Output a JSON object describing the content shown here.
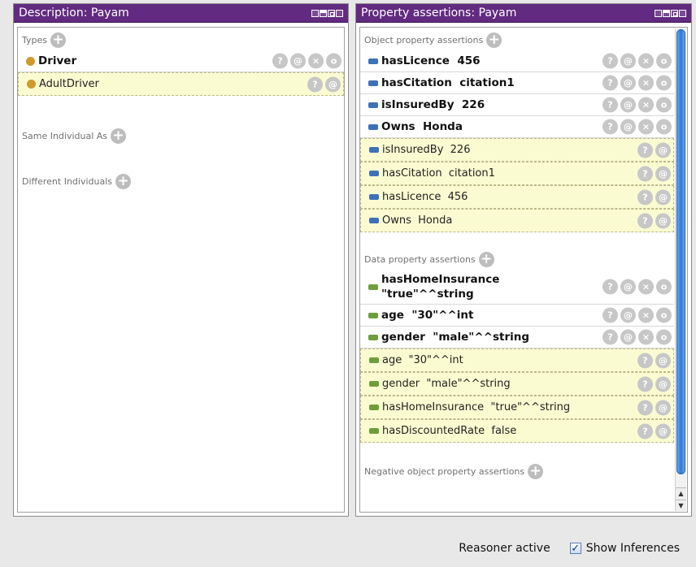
{
  "left": {
    "title": "Description: Payam",
    "types_header": "Types",
    "types_items": [
      {
        "label": "Driver",
        "inferred": false
      },
      {
        "label": "AdultDriver",
        "inferred": true
      }
    ],
    "same_header": "Same Individual As",
    "different_header": "Different Individuals"
  },
  "right": {
    "title": "Property assertions: Payam",
    "obj_header": "Object property assertions",
    "obj_asserted": [
      "hasLicence  456",
      "hasCitation  citation1",
      "isInsuredBy  226",
      "Owns  Honda"
    ],
    "obj_inferred": [
      "isInsuredBy  226",
      "hasCitation  citation1",
      "hasLicence  456",
      "Owns  Honda"
    ],
    "data_header": "Data property assertions",
    "data_asserted": [
      "hasHomeInsurance\n\"true\"^^string",
      "age  \"30\"^^int",
      "gender  \"male\"^^string"
    ],
    "data_inferred": [
      "age  \"30\"^^int",
      "gender  \"male\"^^string",
      "hasHomeInsurance  \"true\"^^string",
      "hasDiscountedRate  false"
    ],
    "neg_header": "Negative object property assertions"
  },
  "buttons": {
    "help": "?",
    "annotate": "@",
    "delete": "×",
    "edit": "o",
    "add": "+"
  },
  "status": {
    "reasoner": "Reasoner active",
    "show_inferences": "Show Inferences",
    "show_inferences_checked": true
  },
  "colors": {
    "titlebar": "#622a80",
    "individual_icon": "#cf9a2c",
    "object_property_icon": "#3e71b8",
    "data_property_icon": "#6e9e3a",
    "inferred_background": "#fbfbd2"
  }
}
